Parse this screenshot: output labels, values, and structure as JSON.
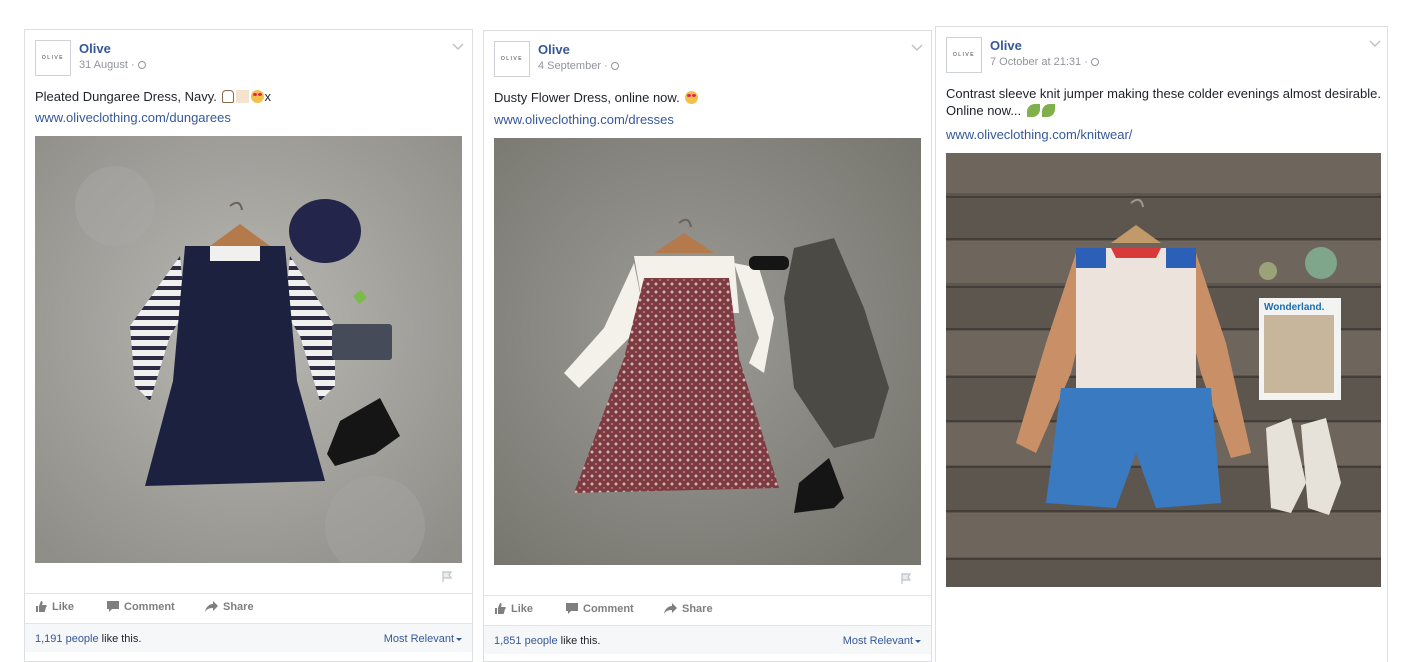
{
  "posts": [
    {
      "page_name": "Olive",
      "avatar_text": "OLIVE",
      "time": "31 August",
      "separator": "·",
      "text": "Pleated Dungaree Dress, Navy.",
      "text_suffix": "x",
      "link": "www.oliveclothing.com/dungarees",
      "actions": {
        "like": "Like",
        "comment": "Comment",
        "share": "Share"
      },
      "likes_count": "1,191 people",
      "likes_suffix": " like this.",
      "sort_label": "Most Relevant"
    },
    {
      "page_name": "Olive",
      "avatar_text": "OLIVE",
      "time": "4 September",
      "separator": "·",
      "text": "Dusty Flower Dress, online now.",
      "link": "www.oliveclothing.com/dresses",
      "actions": {
        "like": "Like",
        "comment": "Comment",
        "share": "Share"
      },
      "likes_count": "1,851 people",
      "likes_suffix": " like this.",
      "sort_label": "Most Relevant"
    },
    {
      "page_name": "Olive",
      "avatar_text": "OLIVE",
      "time": "7 October at 21:31",
      "separator": "·",
      "text": "Contrast sleeve knit jumper making these colder evenings almost desirable. Online now...",
      "link": "www.oliveclothing.com/knitwear/",
      "magazine_title": "Wonderland."
    }
  ],
  "colors": {
    "link": "#365899",
    "muted": "#90949c",
    "border": "#dddfe2"
  },
  "icons": [
    "globe-icon",
    "chevron-down-icon",
    "flag-icon",
    "thumbs-up-icon",
    "comment-icon",
    "share-icon"
  ]
}
